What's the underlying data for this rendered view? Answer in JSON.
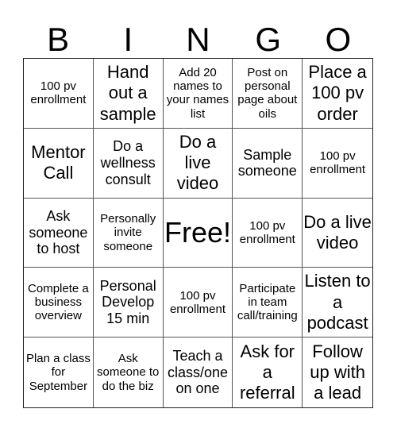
{
  "header": {
    "letters": [
      "B",
      "I",
      "N",
      "G",
      "O"
    ]
  },
  "board": {
    "cells": [
      {
        "text": "100 pv enrollment",
        "size": "small"
      },
      {
        "text": "Hand out a sample",
        "size": "large"
      },
      {
        "text": "Add 20 names to your names list",
        "size": "small"
      },
      {
        "text": "Post on personal page about oils",
        "size": "small"
      },
      {
        "text": "Place a 100 pv order",
        "size": "large"
      },
      {
        "text": "Mentor Call",
        "size": "large"
      },
      {
        "text": "Do a wellness consult",
        "size": "med"
      },
      {
        "text": "Do a live video",
        "size": "large"
      },
      {
        "text": "Sample someone",
        "size": "med"
      },
      {
        "text": "100 pv enrollment",
        "size": "small"
      },
      {
        "text": "Ask someone to host",
        "size": "med"
      },
      {
        "text": "Personally invite someone",
        "size": "small"
      },
      {
        "text": "Free!",
        "size": "free"
      },
      {
        "text": "100 pv enrollment",
        "size": "small"
      },
      {
        "text": "Do a live video",
        "size": "large"
      },
      {
        "text": "Complete a business overview",
        "size": "small"
      },
      {
        "text": "Personal Develop 15 min",
        "size": "med"
      },
      {
        "text": "100 pv enrollment",
        "size": "small"
      },
      {
        "text": "Participate in team call/training",
        "size": "small"
      },
      {
        "text": "Listen to a podcast",
        "size": "large"
      },
      {
        "text": "Plan a class for September",
        "size": "small"
      },
      {
        "text": "Ask someone to do the biz",
        "size": "small"
      },
      {
        "text": "Teach a class/one on one",
        "size": "med"
      },
      {
        "text": "Ask for a referral",
        "size": "large"
      },
      {
        "text": "Follow up with a lead",
        "size": "large"
      }
    ]
  }
}
